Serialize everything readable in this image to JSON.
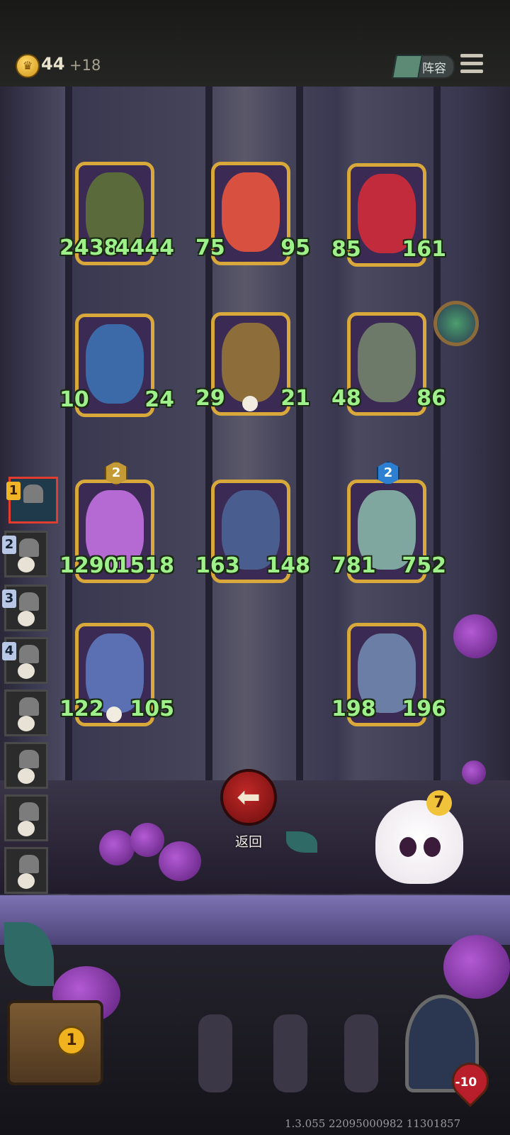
{
  "topbar": {
    "coins": "44",
    "income": "+18",
    "lineup_label": "阵容"
  },
  "board": {
    "cards": [
      {
        "attack": "2438",
        "health": "4444",
        "color": "#5a6a3a"
      },
      {
        "attack": "75",
        "health": "95",
        "color": "#d8503f"
      },
      {
        "attack": "85",
        "health": "161",
        "color": "#c12b3c"
      },
      {
        "attack": "10",
        "health": "24",
        "color": "#3c6aa8"
      },
      {
        "attack": "29",
        "health": "21",
        "color": "#8d6d3a"
      },
      {
        "attack": "48",
        "health": "86",
        "color": "#6d7a6a"
      },
      {
        "attack": "1290",
        "health": "1518",
        "color": "#b46ad2",
        "level": "2"
      },
      {
        "attack": "163",
        "health": "148",
        "color": "#4a5d8f"
      },
      {
        "attack": "781",
        "health": "752",
        "color": "#7fa7a0",
        "level": "2"
      },
      {
        "attack": "122",
        "health": "105",
        "color": "#5b6fb3"
      },
      {
        "attack": "198",
        "health": "196",
        "color": "#6b7fa6"
      }
    ]
  },
  "sidebar": {
    "slots": [
      "1",
      "2",
      "3",
      "4"
    ]
  },
  "back": {
    "label": "返回"
  },
  "mascot": {
    "badge": "7"
  },
  "chest": {
    "count": "1"
  },
  "hero": {
    "health": "-10"
  },
  "version": "1.3.055 22095000982 11301857"
}
